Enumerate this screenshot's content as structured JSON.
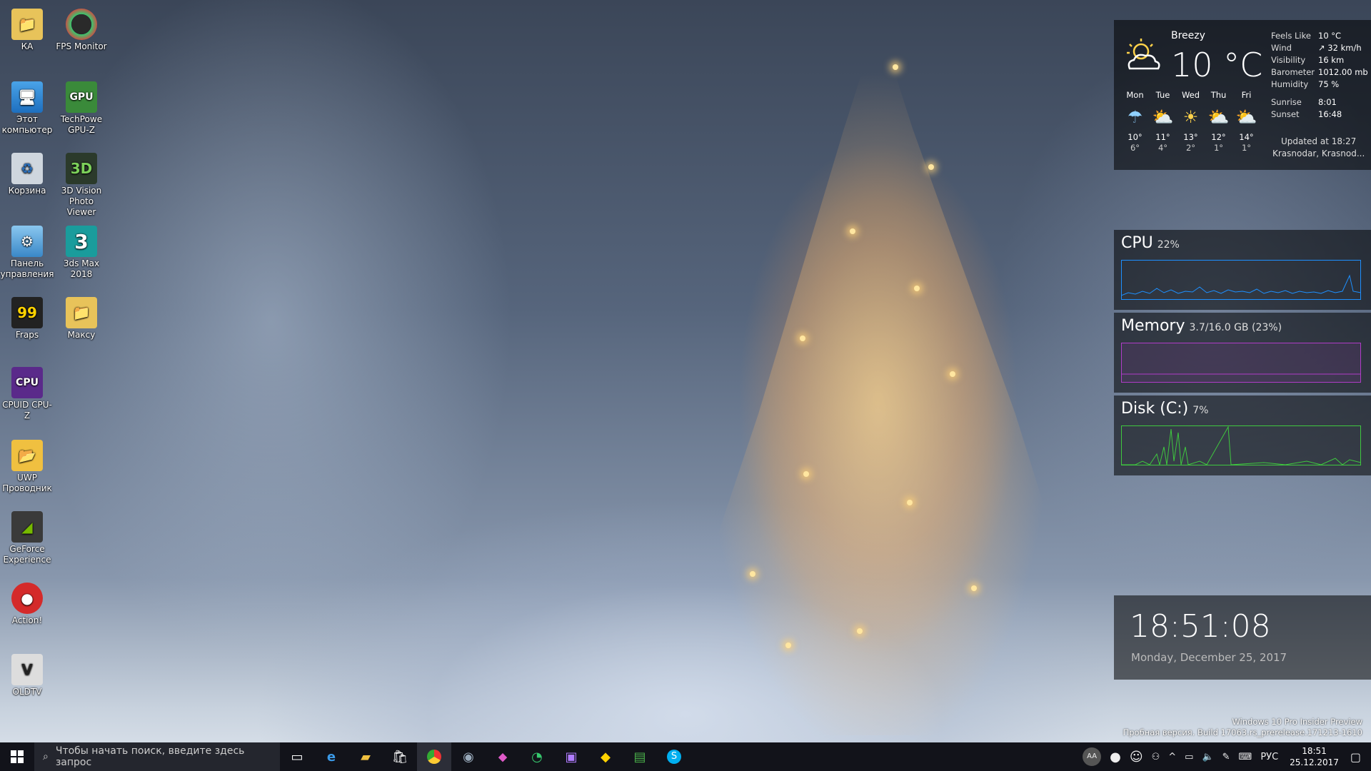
{
  "desktop_icons": [
    {
      "label": "КА",
      "icon": "folder-icon"
    },
    {
      "label": "FPS Monitor",
      "icon": "gauge-icon"
    },
    {
      "label": "Этот компьютер",
      "icon": "computer-icon"
    },
    {
      "label": "TechPowe GPU-Z",
      "icon": "gpu-z-icon"
    },
    {
      "label": "Корзина",
      "icon": "recycle-bin-icon"
    },
    {
      "label": "3D Vision Photo Viewer",
      "icon": "3d-vision-icon"
    },
    {
      "label": "Панель управления",
      "icon": "control-panel-icon"
    },
    {
      "label": "3ds Max 2018",
      "icon": "3ds-max-icon"
    },
    {
      "label": "Fraps",
      "icon": "fraps-icon"
    },
    {
      "label": "Макcу",
      "icon": "folder-icon"
    },
    {
      "label": "CPUID CPU-Z",
      "icon": "cpu-z-icon"
    },
    {
      "label": "UWP Проводник",
      "icon": "folder-icon"
    },
    {
      "label": "GeForce Experience",
      "icon": "geforce-icon"
    },
    {
      "label": "Action!",
      "icon": "action-icon"
    },
    {
      "label": "OLDTV",
      "icon": "oldtv-icon"
    }
  ],
  "weather": {
    "condition": "Breezy",
    "temperature": "10 °C",
    "details": [
      {
        "key": "Feels Like",
        "value": "10 °C"
      },
      {
        "key": "Wind",
        "value": "↗ 32 km/h"
      },
      {
        "key": "Visibility",
        "value": "16 km"
      },
      {
        "key": "Barometer",
        "value": "1012.00 mb"
      },
      {
        "key": "Humidity",
        "value": "75 %"
      }
    ],
    "sun": [
      {
        "key": "Sunrise",
        "value": "8:01"
      },
      {
        "key": "Sunset",
        "value": "16:48"
      }
    ],
    "forecast": [
      {
        "day": "Mon",
        "high": "10°",
        "low": "6°",
        "icon": "cloud-rain-icon"
      },
      {
        "day": "Tue",
        "high": "11°",
        "low": "4°",
        "icon": "partly-cloudy-icon"
      },
      {
        "day": "Wed",
        "high": "13°",
        "low": "2°",
        "icon": "sun-icon"
      },
      {
        "day": "Thu",
        "high": "12°",
        "low": "1°",
        "icon": "partly-cloudy-icon"
      },
      {
        "day": "Fri",
        "high": "14°",
        "low": "1°",
        "icon": "partly-cloudy-icon"
      }
    ],
    "updated": "Updated at 18:27",
    "location": "Krasnodar, Krasnod..."
  },
  "perf": {
    "cpu": {
      "title": "CPU",
      "value": "22%",
      "color": "#1e90ff"
    },
    "memory": {
      "title": "Memory",
      "value": "3.7/16.0 GB (23%)",
      "color": "#b03cc8"
    },
    "disk": {
      "title": "Disk (C:)",
      "value": "7%",
      "color": "#3fc83f"
    }
  },
  "clock": {
    "time": "18:51:08",
    "date": "Monday, December 25, 2017"
  },
  "watermark": {
    "line1": "Windows 10 Pro Insider Preview",
    "line2": "Пробная версия. Build 17063.rs_prerelease.171213-1610"
  },
  "taskbar": {
    "search_placeholder": "Чтобы начать поиск, введите здесь запрос",
    "language": "РУС",
    "time": "18:51",
    "date": "25.12.2017",
    "avatar_initials": "AA"
  }
}
